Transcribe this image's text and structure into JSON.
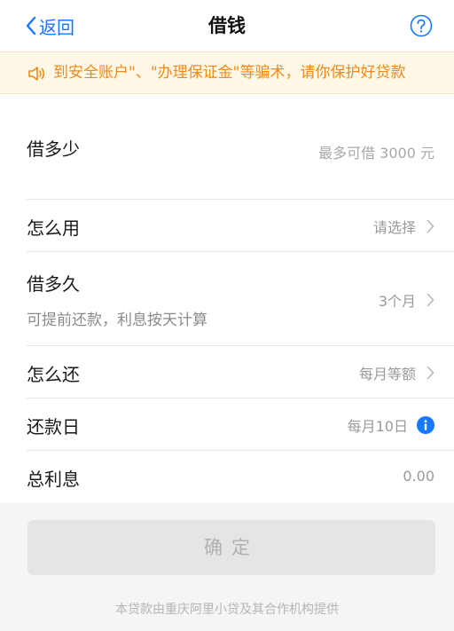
{
  "nav": {
    "back_label": "返回",
    "title": "借钱"
  },
  "notice": {
    "text": "到安全账户\"、\"办理保证金\"等骗术，请你保护好贷款"
  },
  "form": {
    "amount": {
      "label": "借多少",
      "placeholder": "最多可借 3000 元"
    },
    "purpose": {
      "label": "怎么用",
      "value": "请选择"
    },
    "term": {
      "label": "借多久",
      "sub": "可提前还款，利息按天计算",
      "value": "3个月"
    },
    "repay_method": {
      "label": "怎么还",
      "value": "每月等额"
    },
    "repay_day": {
      "label": "还款日",
      "value": "每月10日"
    },
    "interest": {
      "label": "总利息",
      "value": "0.00"
    }
  },
  "footer": {
    "confirm_label": "确定",
    "provider_text": "本贷款由重庆阿里小贷及其合作机构提供"
  },
  "colors": {
    "accent": "#1677ff",
    "notice_text": "#f08a1a",
    "notice_bg": "#fff8e6",
    "button_disabled_bg": "#e5e5e5",
    "button_disabled_text": "#b0b0b0"
  },
  "icons": {
    "back": "chevron-left-icon",
    "help": "question-circle-icon",
    "notice": "speaker-icon",
    "row_arrow": "chevron-right-icon",
    "info": "info-circle-icon"
  }
}
